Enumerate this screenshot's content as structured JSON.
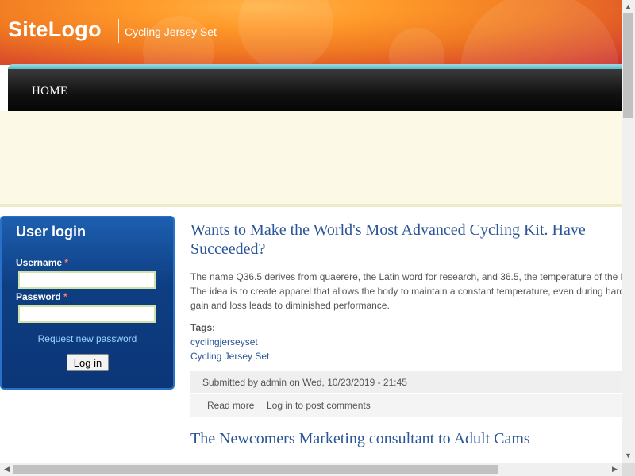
{
  "site": {
    "logo": "SiteLogo",
    "slogan": "Cycling Jersey Set"
  },
  "nav": {
    "home": "HOME"
  },
  "login": {
    "title": "User login",
    "username_label": "Username",
    "password_label": "Password",
    "required_mark": "*",
    "request_password": "Request new password",
    "button": "Log in"
  },
  "article1": {
    "title_line1": "Wants to Make the World's Most Advanced Cycling Kit. Have",
    "title_line2": "Succeeded?",
    "body": [
      "The name Q36.5 derives from quaerere, the Latin word for research, and 36.5, the temperature of the h",
      "The idea is to create apparel that allows the body to maintain a constant temperature, even during hard",
      "gain and loss leads to diminished performance."
    ],
    "tags_label": "Tags:",
    "tags": [
      "cyclingjerseyset",
      "Cycling Jersey Set"
    ],
    "submitted": "Submitted by admin on Wed, 10/23/2019 - 21:45",
    "read_more": "Read more",
    "login_to_comment": "Log in to post comments"
  },
  "article2": {
    "title": "The Newcomers Marketing consultant to Adult Cams"
  },
  "scrollbar": {
    "up": "▲",
    "down": "▼",
    "left": "◀",
    "right": "▶"
  }
}
